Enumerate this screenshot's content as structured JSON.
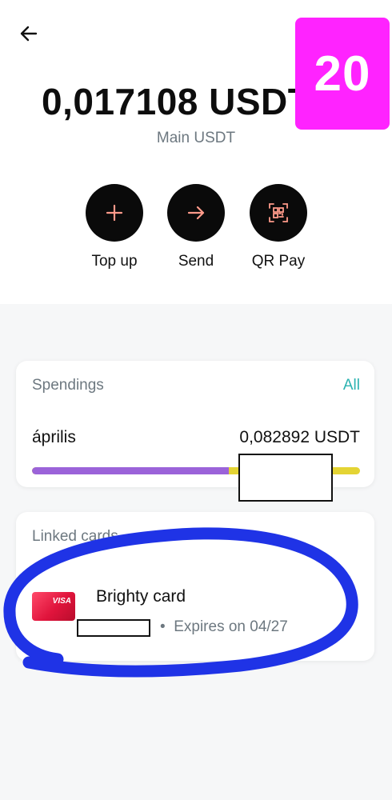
{
  "header": {
    "back_icon": "arrow-left-icon",
    "badge_number": "20",
    "badge_color": "#ff23ff"
  },
  "balance": {
    "amount": "0,017108 USDT",
    "wallet_name": "Main USDT"
  },
  "actions": [
    {
      "label": "Top up",
      "icon": "plus-icon"
    },
    {
      "label": "Send",
      "icon": "arrow-right-icon"
    },
    {
      "label": "QR Pay",
      "icon": "qr-icon"
    }
  ],
  "spendings": {
    "title": "Spendings",
    "all_label": "All",
    "month": "április",
    "amount": "0,082892 USDT",
    "bar_colors": {
      "primary": "#9b63d9",
      "secondary": "#e4d434"
    },
    "bar_primary_fraction": 0.6
  },
  "linked_cards": {
    "title": "Linked cards",
    "cards": [
      {
        "name": "Brighty card",
        "brand": "VISA",
        "expiry": "Expires on 04/27",
        "separator": "•"
      }
    ]
  },
  "colors": {
    "accent": "#2bb3b1",
    "muted_text": "#6d7880",
    "action_bg": "#0a0a0a",
    "action_icon": "#ff9a8a",
    "annotation_scribble": "#1f33e6"
  }
}
